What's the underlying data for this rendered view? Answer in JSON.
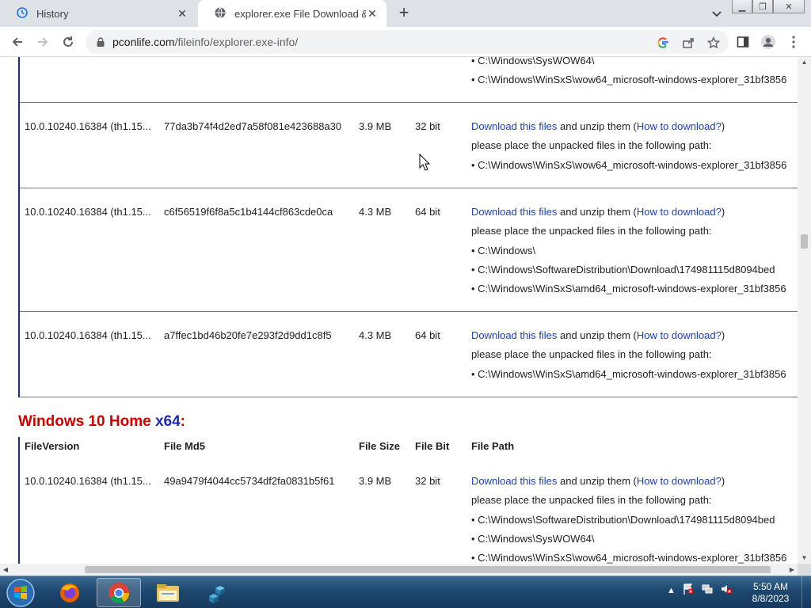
{
  "browser": {
    "tabs": [
      {
        "title": "History"
      },
      {
        "title": "explorer.exe File Download & Fix"
      }
    ],
    "url_host": "pconlife.com",
    "url_path": "/fileinfo/explorer.exe-info/"
  },
  "content": {
    "top_partial_paths": [
      "• C:\\Windows\\SysWOW64\\",
      "• C:\\Windows\\WinSxS\\wow64_microsoft-windows-explorer_31bf3856"
    ],
    "rows": [
      {
        "version": "10.0.10240.16384 (th1.15...",
        "md5": "77da3b74f4d2ed7a58f081e423688a30",
        "size": "3.9 MB",
        "bit": "32 bit",
        "download_link": "Download this files",
        "mid_text": " and unzip them (",
        "howto_link": "How to download?",
        "end_text": ")",
        "place_text": "please place the unpacked files in the following path:",
        "paths": [
          "• C:\\Windows\\WinSxS\\wow64_microsoft-windows-explorer_31bf3856"
        ]
      },
      {
        "version": "10.0.10240.16384 (th1.15...",
        "md5": "c6f56519f6f8a5c1b4144cf863cde0ca",
        "size": "4.3 MB",
        "bit": "64 bit",
        "download_link": "Download this files",
        "mid_text": " and unzip them (",
        "howto_link": "How to download?",
        "end_text": ")",
        "place_text": "please place the unpacked files in the following path:",
        "paths": [
          "• C:\\Windows\\",
          "• C:\\Windows\\SoftwareDistribution\\Download\\174981115d8094bed",
          "• C:\\Windows\\WinSxS\\amd64_microsoft-windows-explorer_31bf3856"
        ]
      },
      {
        "version": "10.0.10240.16384 (th1.15...",
        "md5": "a7ffec1bd46b20fe7e293f2d9dd1c8f5",
        "size": "4.3 MB",
        "bit": "64 bit",
        "download_link": "Download this files",
        "mid_text": " and unzip them (",
        "howto_link": "How to download?",
        "end_text": ")",
        "place_text": "please place the unpacked files in the following path:",
        "paths": [
          "• C:\\Windows\\WinSxS\\amd64_microsoft-windows-explorer_31bf3856"
        ]
      }
    ],
    "section": {
      "title_main": "Windows 10 Home ",
      "title_arch": "x64",
      "title_colon": ":",
      "headers": {
        "version": "FileVersion",
        "md5": "File Md5",
        "size": "File Size",
        "bit": "File Bit",
        "path": "File Path"
      },
      "row": {
        "version": "10.0.10240.16384 (th1.15...",
        "md5": "49a9479f4044cc5734df2fa0831b5f61",
        "size": "3.9 MB",
        "bit": "32 bit",
        "download_link": "Download this files",
        "mid_text": " and unzip them (",
        "howto_link": "How to download?",
        "end_text": ")",
        "place_text": "please place the unpacked files in the following path:",
        "paths": [
          "• C:\\Windows\\SoftwareDistribution\\Download\\174981115d8094bed",
          "• C:\\Windows\\SysWOW64\\",
          "• C:\\Windows\\WinSxS\\wow64_microsoft-windows-explorer_31bf3856"
        ]
      }
    }
  },
  "taskbar": {
    "time": "5:50 AM",
    "date": "8/8/2023"
  },
  "colors": {
    "accent_red": "#d00000",
    "accent_blue": "#1a2ab8",
    "link": "#1a3fbf",
    "block_border": "#1a2a9a"
  }
}
